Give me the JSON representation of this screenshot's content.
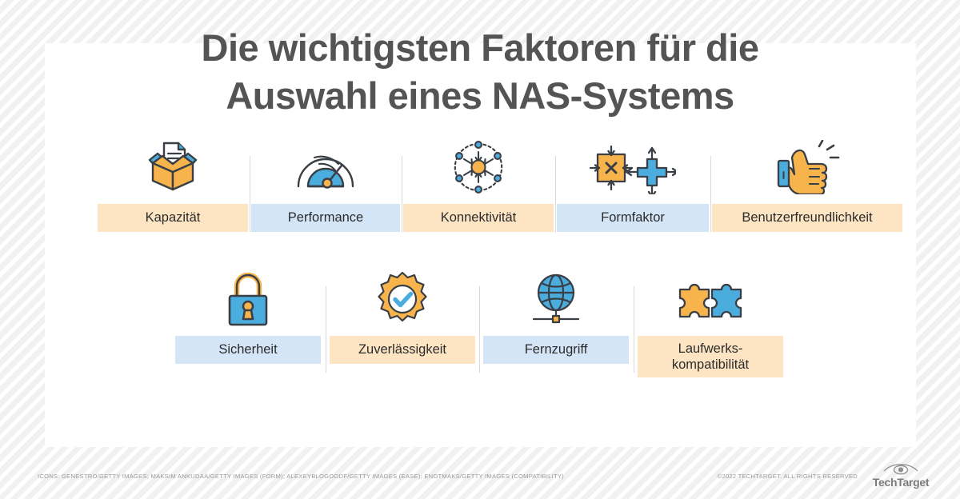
{
  "title": {
    "line1": "Die wichtigsten Faktoren für die",
    "line2": "Auswahl eines NAS-Systems",
    "color": "#545454"
  },
  "colors": {
    "peach": "#fde5c3",
    "blue": "#d4e5f7",
    "icon_orange": "#f8b44c",
    "icon_blue": "#4aadde",
    "icon_outline": "#3a3f46",
    "divider": "#d9d9d9",
    "card": "#ffffff",
    "page_background": "#f6f6f6"
  },
  "rows": [
    {
      "name": "row-1",
      "items": [
        {
          "label": "Kapazität",
          "tone": "peach",
          "icon": "open-box-document-icon"
        },
        {
          "label": "Performance",
          "tone": "blue",
          "icon": "speedometer-icon"
        },
        {
          "label": "Konnektivität",
          "tone": "peach",
          "icon": "network-hub-icon"
        },
        {
          "label": "Formfaktor",
          "tone": "blue",
          "icon": "shrink-expand-squares-icon"
        },
        {
          "label": "Benutzerfreundlichkeit",
          "tone": "peach",
          "icon": "pointing-hand-icon"
        }
      ]
    },
    {
      "name": "row-2",
      "items": [
        {
          "label": "Sicherheit",
          "tone": "blue",
          "icon": "padlock-icon"
        },
        {
          "label": "Zuverlässigkeit",
          "tone": "peach",
          "icon": "check-badge-icon"
        },
        {
          "label": "Fernzugriff",
          "tone": "blue",
          "icon": "globe-network-icon"
        },
        {
          "label": "Laufwerks-\nkompatibilität",
          "tone": "peach",
          "icon": "puzzle-pieces-icon"
        }
      ]
    }
  ],
  "footer": {
    "credits": "ICONS: GENESTRO/GETTY IMAGES; MAKSIM ANKUDAA/GETTY IMAGES (FORM); ALEXEYBLOGOODF/GETTY IMAGES (EASE); ENOTMAKS/GETTY IMAGES (COMPATIBILITY)",
    "copyright": "©2022 TECHTARGET. ALL RIGHTS RESERVED",
    "brand": "TechTarget"
  }
}
